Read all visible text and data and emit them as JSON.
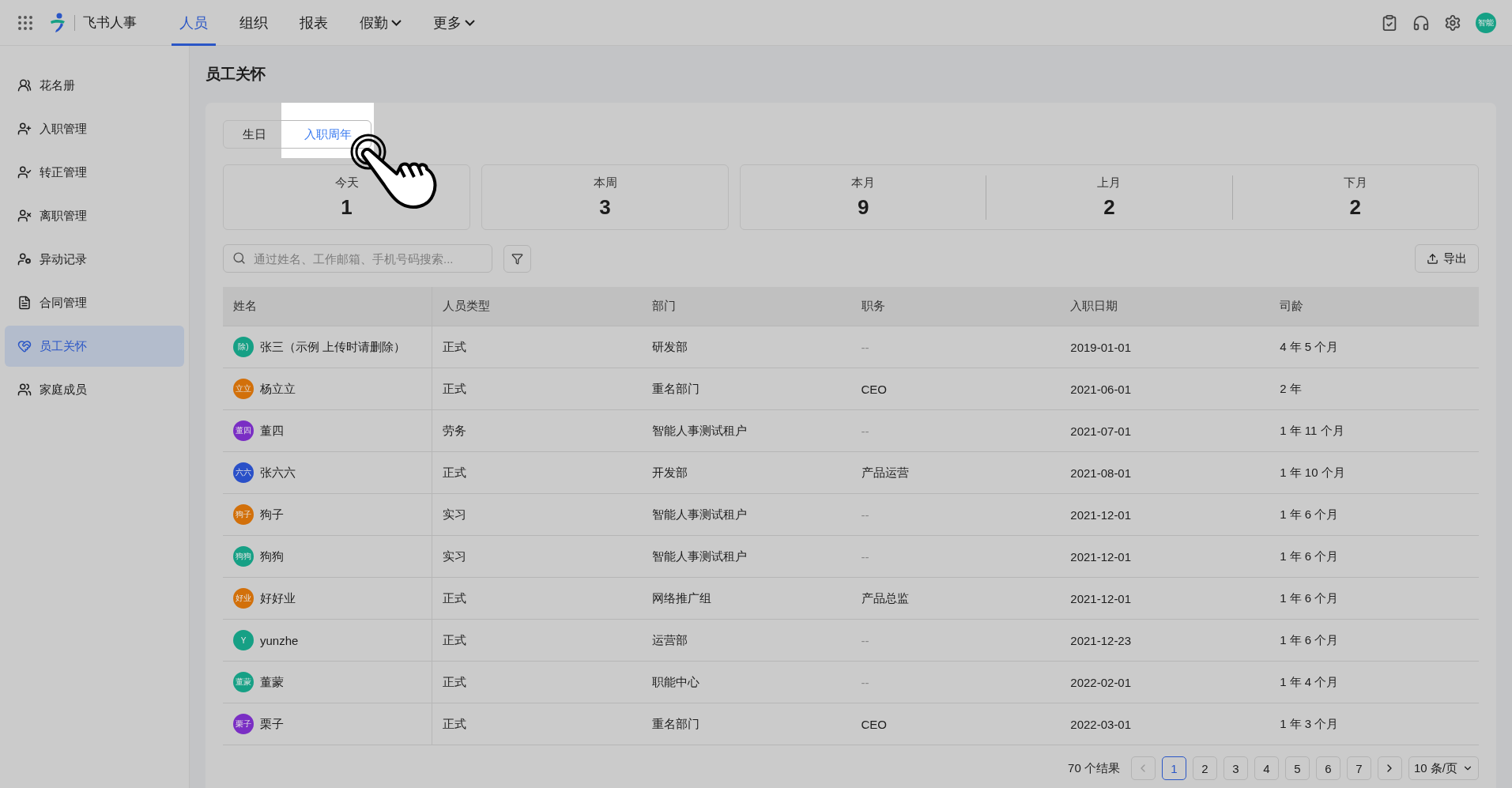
{
  "app": {
    "name": "飞书人事",
    "avatar": "智能"
  },
  "nav": [
    {
      "label": "人员",
      "selected": true,
      "dropdown": false
    },
    {
      "label": "组织",
      "selected": false,
      "dropdown": false
    },
    {
      "label": "报表",
      "selected": false,
      "dropdown": false
    },
    {
      "label": "假勤",
      "selected": false,
      "dropdown": true
    },
    {
      "label": "更多",
      "selected": false,
      "dropdown": true
    }
  ],
  "sidebar": {
    "items": [
      {
        "label": "花名册",
        "selected": false
      },
      {
        "label": "入职管理",
        "selected": false
      },
      {
        "label": "转正管理",
        "selected": false
      },
      {
        "label": "离职管理",
        "selected": false
      },
      {
        "label": "异动记录",
        "selected": false
      },
      {
        "label": "合同管理",
        "selected": false
      },
      {
        "label": "员工关怀",
        "selected": true
      },
      {
        "label": "家庭成员",
        "selected": false
      }
    ]
  },
  "page": {
    "title": "员工关怀"
  },
  "tabs": [
    {
      "label": "生日",
      "selected": false
    },
    {
      "label": "入职周年",
      "selected": true
    }
  ],
  "stat_cards": [
    {
      "items": [
        {
          "label": "今天",
          "value": "1"
        }
      ]
    },
    {
      "items": [
        {
          "label": "本周",
          "value": "3"
        }
      ]
    },
    {
      "items": [
        {
          "label": "本月",
          "value": "9"
        },
        {
          "label": "上月",
          "value": "2"
        },
        {
          "label": "下月",
          "value": "2"
        }
      ]
    }
  ],
  "search": {
    "placeholder": "通过姓名、工作邮箱、手机号码搜索..."
  },
  "export_button": "导出",
  "table": {
    "columns": [
      "姓名",
      "人员类型",
      "部门",
      "职务",
      "入职日期",
      "司龄"
    ],
    "rows": [
      {
        "avatar": "除)",
        "color": "#16a085",
        "cells": [
          "张三（示例 上传时请删除）",
          "正式",
          "研发部",
          "--",
          "2019-01-01",
          "4 年 5 个月"
        ]
      },
      {
        "avatar": "立立",
        "color": "#d2700a",
        "cells": [
          "杨立立",
          "正式",
          "重名部门",
          "CEO",
          "2021-06-01",
          "2 年"
        ]
      },
      {
        "avatar": "董四",
        "color": "#7a2ec4",
        "cells": [
          "董四",
          "劳务",
          "智能人事测试租户",
          "--",
          "2021-07-01",
          "1 年 11 个月"
        ]
      },
      {
        "avatar": "六六",
        "color": "#2a50c8",
        "cells": [
          "张六六",
          "正式",
          "开发部",
          "产品运营",
          "2021-08-01",
          "1 年 10 个月"
        ]
      },
      {
        "avatar": "狗子",
        "color": "#d2700a",
        "cells": [
          "狗子",
          "实习",
          "智能人事测试租户",
          "--",
          "2021-12-01",
          "1 年 6 个月"
        ]
      },
      {
        "avatar": "狗狗",
        "color": "#16a085",
        "cells": [
          "狗狗",
          "实习",
          "智能人事测试租户",
          "--",
          "2021-12-01",
          "1 年 6 个月"
        ]
      },
      {
        "avatar": "好业",
        "color": "#d2700a",
        "cells": [
          "好好业",
          "正式",
          "网络推广组",
          "产品总监",
          "2021-12-01",
          "1 年 6 个月"
        ]
      },
      {
        "avatar": "Y",
        "color": "#16a085",
        "cells": [
          "yunzhe",
          "正式",
          "运营部",
          "--",
          "2021-12-23",
          "1 年 6 个月"
        ]
      },
      {
        "avatar": "董蒙",
        "color": "#16a085",
        "cells": [
          "董蒙",
          "正式",
          "职能中心",
          "--",
          "2022-02-01",
          "1 年 4 个月"
        ]
      },
      {
        "avatar": "栗子",
        "color": "#7a2ec4",
        "cells": [
          "栗子",
          "正式",
          "重名部门",
          "CEO",
          "2022-03-01",
          "1 年 3 个月"
        ]
      }
    ]
  },
  "pagination": {
    "total": "70 个结果",
    "pages": [
      {
        "label": "1",
        "selected": true
      },
      {
        "label": "2",
        "selected": false
      },
      {
        "label": "3",
        "selected": false
      },
      {
        "label": "4",
        "selected": false
      },
      {
        "label": "5",
        "selected": false
      },
      {
        "label": "6",
        "selected": false
      },
      {
        "label": "7",
        "selected": false
      }
    ],
    "page_size": "10 条/页"
  }
}
